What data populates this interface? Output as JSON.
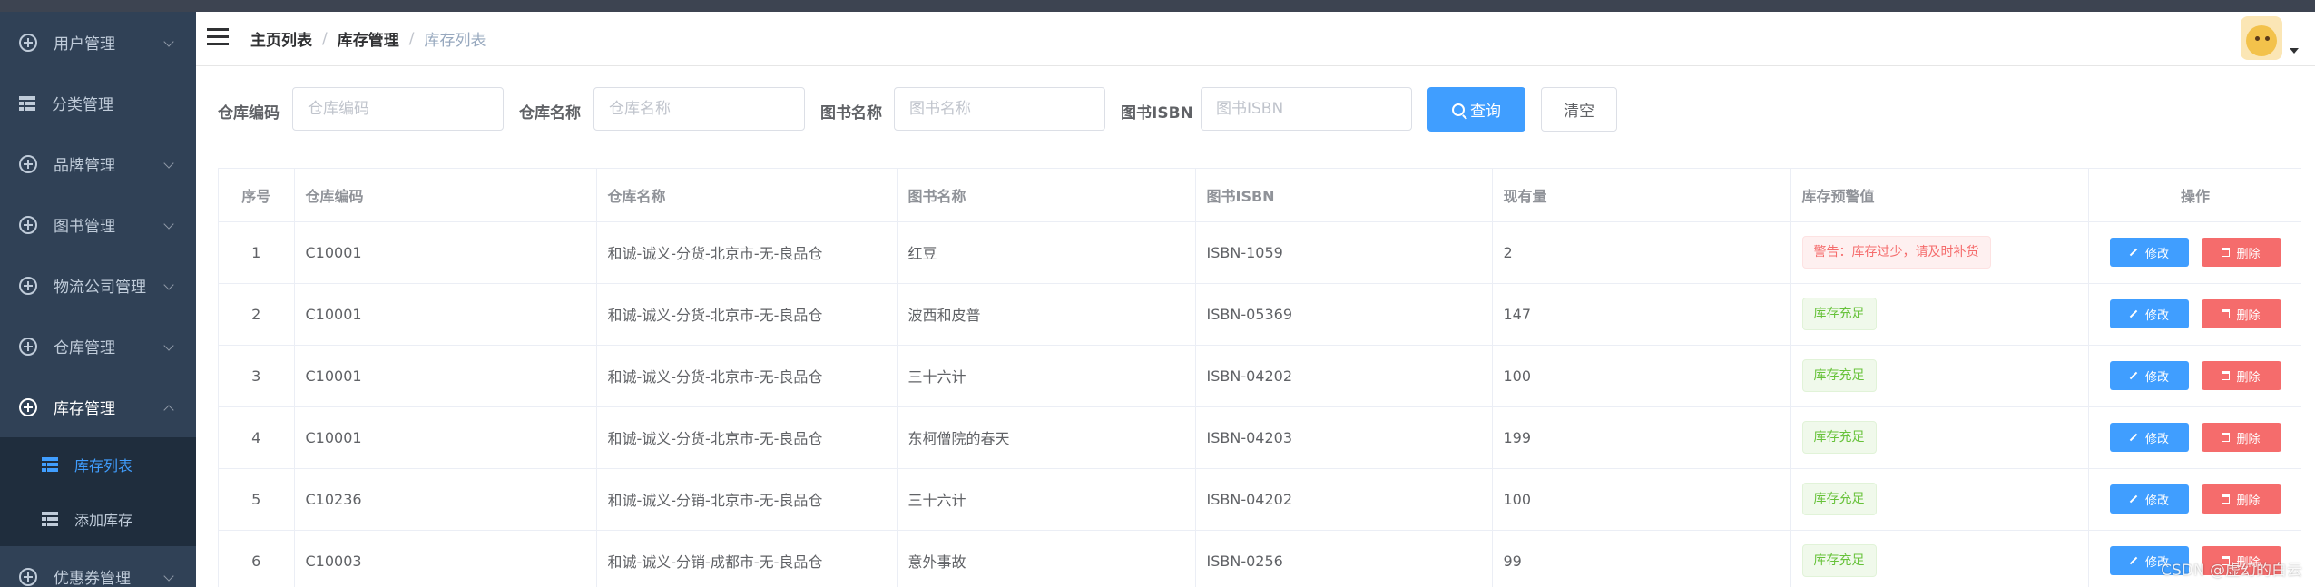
{
  "sidebar": {
    "items": [
      {
        "label": "用户管理"
      },
      {
        "label": "分类管理"
      },
      {
        "label": "品牌管理"
      },
      {
        "label": "图书管理"
      },
      {
        "label": "物流公司管理"
      },
      {
        "label": "仓库管理"
      },
      {
        "label": "库存管理"
      },
      {
        "label": "优惠券管理"
      }
    ],
    "submenu": [
      {
        "label": "库存列表"
      },
      {
        "label": "添加库存"
      }
    ]
  },
  "breadcrumb": [
    "主页列表",
    "库存管理",
    "库存列表"
  ],
  "filters": {
    "warehouse_code": {
      "label": "仓库编码",
      "placeholder": "仓库编码"
    },
    "warehouse_name": {
      "label": "仓库名称",
      "placeholder": "仓库名称"
    },
    "book_name": {
      "label": "图书名称",
      "placeholder": "图书名称"
    },
    "book_isbn": {
      "label": "图书ISBN",
      "placeholder": "图书ISBN"
    },
    "query_label": "查询",
    "clear_label": "清空"
  },
  "table": {
    "columns": [
      "序号",
      "仓库编码",
      "仓库名称",
      "图书名称",
      "图书ISBN",
      "现有量",
      "库存预警值",
      "操作"
    ],
    "edit_label": "修改",
    "delete_label": "删除",
    "rows": [
      {
        "no": "1",
        "code": "C10001",
        "warehouse": "和诚-诚义-分货-北京市-无-良品仓",
        "book": "红豆",
        "isbn": "ISBN-1059",
        "qty": "2",
        "warning": "警告：库存过少，请及时补货",
        "status": "danger"
      },
      {
        "no": "2",
        "code": "C10001",
        "warehouse": "和诚-诚义-分货-北京市-无-良品仓",
        "book": "波西和皮普",
        "isbn": "ISBN-05369",
        "qty": "147",
        "warning": "库存充足",
        "status": "success"
      },
      {
        "no": "3",
        "code": "C10001",
        "warehouse": "和诚-诚义-分货-北京市-无-良品仓",
        "book": "三十六计",
        "isbn": "ISBN-04202",
        "qty": "100",
        "warning": "库存充足",
        "status": "success"
      },
      {
        "no": "4",
        "code": "C10001",
        "warehouse": "和诚-诚义-分货-北京市-无-良品仓",
        "book": "东柯僧院的春天",
        "isbn": "ISBN-04203",
        "qty": "199",
        "warning": "库存充足",
        "status": "success"
      },
      {
        "no": "5",
        "code": "C10236",
        "warehouse": "和诚-诚义-分销-北京市-无-良品仓",
        "book": "三十六计",
        "isbn": "ISBN-04202",
        "qty": "100",
        "warning": "库存充足",
        "status": "success"
      },
      {
        "no": "6",
        "code": "C10003",
        "warehouse": "和诚-诚义-分销-成都市-无-良品仓",
        "book": "意外事故",
        "isbn": "ISBN-0256",
        "qty": "99",
        "warning": "库存充足",
        "status": "success"
      }
    ]
  },
  "watermark": "CSDN @虚幻的白云",
  "colors": {
    "primary": "#409eff",
    "danger": "#f56c6c",
    "success": "#67c23a",
    "sidebar_bg": "#304156"
  }
}
